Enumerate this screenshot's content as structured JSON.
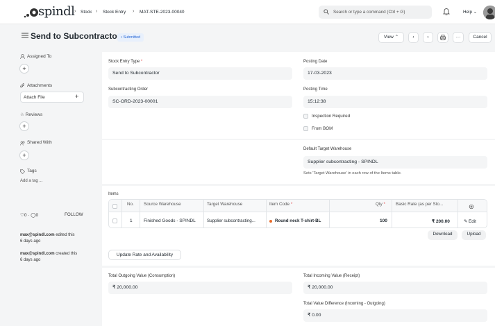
{
  "navbar": {
    "logo": "spindl",
    "breadcrumbs": [
      "Stock",
      "Stock Entry",
      "MAT-STE-2023-00040"
    ],
    "search_placeholder": "Search or type a command (Ctrl + G)",
    "help_label": "Help"
  },
  "header": {
    "title": "Send to Subcontractor",
    "status": "Submitted",
    "view_label": "View",
    "cancel_label": "Cancel"
  },
  "sidebar": {
    "assigned_to": "Assigned To",
    "attachments": "Attachments",
    "attach_file": "Attach File",
    "reviews": "Reviews",
    "shared_with": "Shared With",
    "tags": "Tags",
    "add_tag": "Add a tag ...",
    "likes": "0",
    "comments": "0",
    "follow": "FOLLOW",
    "activity": [
      {
        "user": "max@spindl.com",
        "action": "edited this",
        "time": "6 days ago"
      },
      {
        "user": "max@spindl.com",
        "action": "created this",
        "time": "6 days ago"
      }
    ]
  },
  "form": {
    "stock_entry_type_label": "Stock Entry Type",
    "stock_entry_type": "Send to Subcontractor",
    "posting_date_label": "Posting Date",
    "posting_date": "17-03-2023",
    "subcontracting_order_label": "Subcontracting Order",
    "subcontracting_order": "SC-ORD-2023-00001",
    "posting_time_label": "Posting Time",
    "posting_time": "15:12:38",
    "inspection_required": "Inspection Required",
    "from_bom": "From BOM",
    "default_target_wh_label": "Default Target Warehouse",
    "default_target_wh": "Supplier subcontracting - SPINDL",
    "target_wh_note": "Sets 'Target Warehouse' in each row of the Items table."
  },
  "items": {
    "label": "Items",
    "columns": [
      "No.",
      "Source Warehouse",
      "Target Warehouse",
      "Item Code",
      "Qty",
      "Basic Rate (as per Sto..."
    ],
    "rows": [
      {
        "no": "1",
        "source": "Finished Goods - SPINDL",
        "target": "Supplier subcontracting...",
        "item": "Round neck T-shirt-BL",
        "qty": "100",
        "rate": "₹ 200.00",
        "edit": "Edit"
      }
    ],
    "download": "Download",
    "upload": "Upload",
    "update_rate": "Update Rate and Availability"
  },
  "totals": {
    "outgoing_label": "Total Outgoing Value (Consumption)",
    "outgoing": "₹ 20,000.00",
    "incoming_label": "Total Incoming Value (Receipt)",
    "incoming": "₹ 20,000.00",
    "difference_label": "Total Value Difference (Incoming - Outgoing)",
    "difference": "₹ 0.00"
  }
}
